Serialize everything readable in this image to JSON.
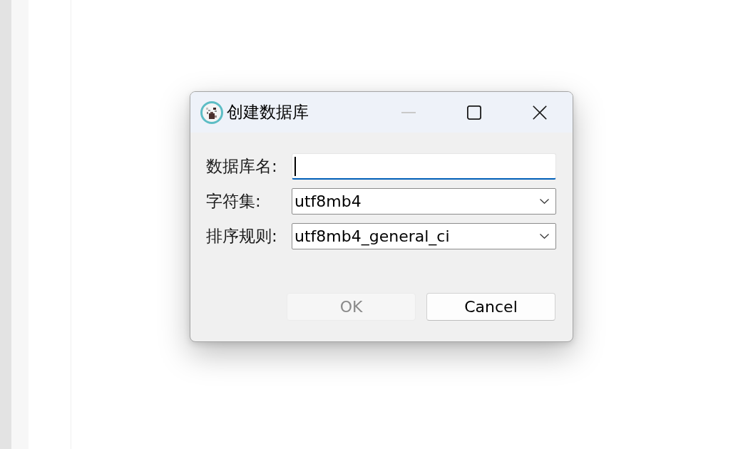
{
  "window": {
    "title": "创建数据库",
    "controls": [
      {
        "kind": "minimize",
        "disabled": true
      },
      {
        "kind": "maximize",
        "disabled": false
      },
      {
        "kind": "close",
        "disabled": false
      }
    ]
  },
  "fields": [
    {
      "kind": "text",
      "label": "数据库名:",
      "focused": true
    },
    {
      "kind": "select",
      "label": "字符集:",
      "value": "utf8mb4",
      "focused": false
    },
    {
      "kind": "select",
      "label": "排序规则:",
      "value": "utf8mb4_general_ci",
      "focused": false
    }
  ],
  "buttons": [
    {
      "label": "OK",
      "disabled": true
    },
    {
      "label": "Cancel",
      "disabled": false
    }
  ]
}
